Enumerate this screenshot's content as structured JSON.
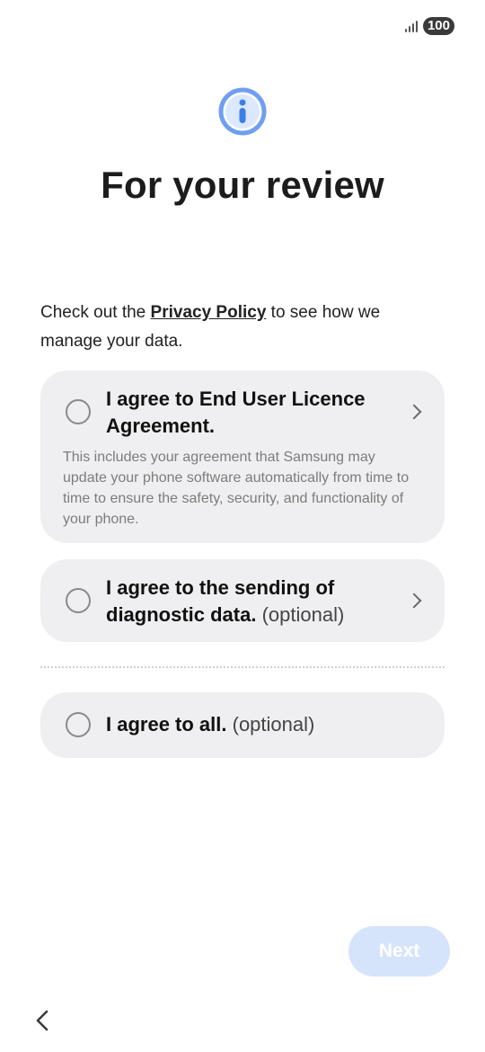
{
  "status_bar": {
    "battery": "100"
  },
  "header": {
    "title": "For your review"
  },
  "intro": {
    "prefix": "Check out the ",
    "link": "Privacy Policy",
    "suffix": " to see how we manage your data."
  },
  "options": [
    {
      "title": "I agree to End User Licence Agreement.",
      "optional": "",
      "description": "This includes your agreement that Samsung may update your phone software automatically from time to time to ensure the safety, security, and functionality of your phone."
    },
    {
      "title": "I agree to the sending of diagnostic data.",
      "optional": " (optional)"
    },
    {
      "title": "I agree to all.",
      "optional": " (optional)"
    }
  ],
  "footer": {
    "next_label": "Next"
  },
  "colors": {
    "accent": "#6f9ff0",
    "next_disabled": "#d6e4fb",
    "card_bg": "#efeff1"
  }
}
